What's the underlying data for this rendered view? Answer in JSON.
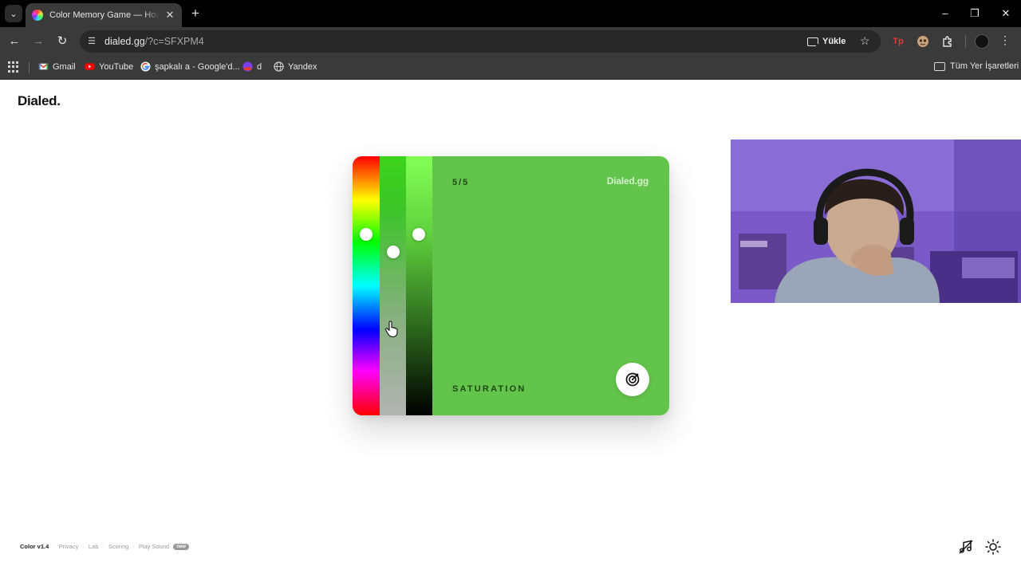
{
  "browser": {
    "tab_title": "Color Memory Game — How Well Can You See Color",
    "tab_close": "✕",
    "new_tab": "+",
    "url_host": "dialed.gg",
    "url_path": "/?c=SFXPM4",
    "install_label": "Yükle",
    "ext_tp": "Tp",
    "window_controls": {
      "minimize": "–",
      "restore": "❐",
      "close": "✕"
    }
  },
  "bookmarks": {
    "items": [
      {
        "label": "Gmail",
        "icon": "gmail-icon",
        "color": "#EA4335"
      },
      {
        "label": "YouTube",
        "icon": "youtube-icon",
        "color": "#FF0000"
      },
      {
        "label": "şapkalı a - Google'd...",
        "icon": "google-icon",
        "color": "#4285F4"
      },
      {
        "label": "d",
        "icon": "bookmark-d-icon",
        "color": "#7B3FF2"
      },
      {
        "label": "Yandex",
        "icon": "globe-icon",
        "color": "#BDBDBD"
      }
    ],
    "all_bookmarks": "Tüm Yer İşaretleri"
  },
  "page": {
    "logo": "Dialed.",
    "card": {
      "round": "5/5",
      "brand": "Dialed.gg",
      "phase": "SATURATION",
      "color": "#62C44A",
      "hue_level": 0.3,
      "saturation_level": 0.37,
      "brightness_level": 0.3
    },
    "footer": {
      "version": "Color v1.4",
      "links": [
        "Privacy",
        "Lab",
        "Scoring",
        "Play Sound"
      ],
      "new_badge": "new"
    }
  }
}
